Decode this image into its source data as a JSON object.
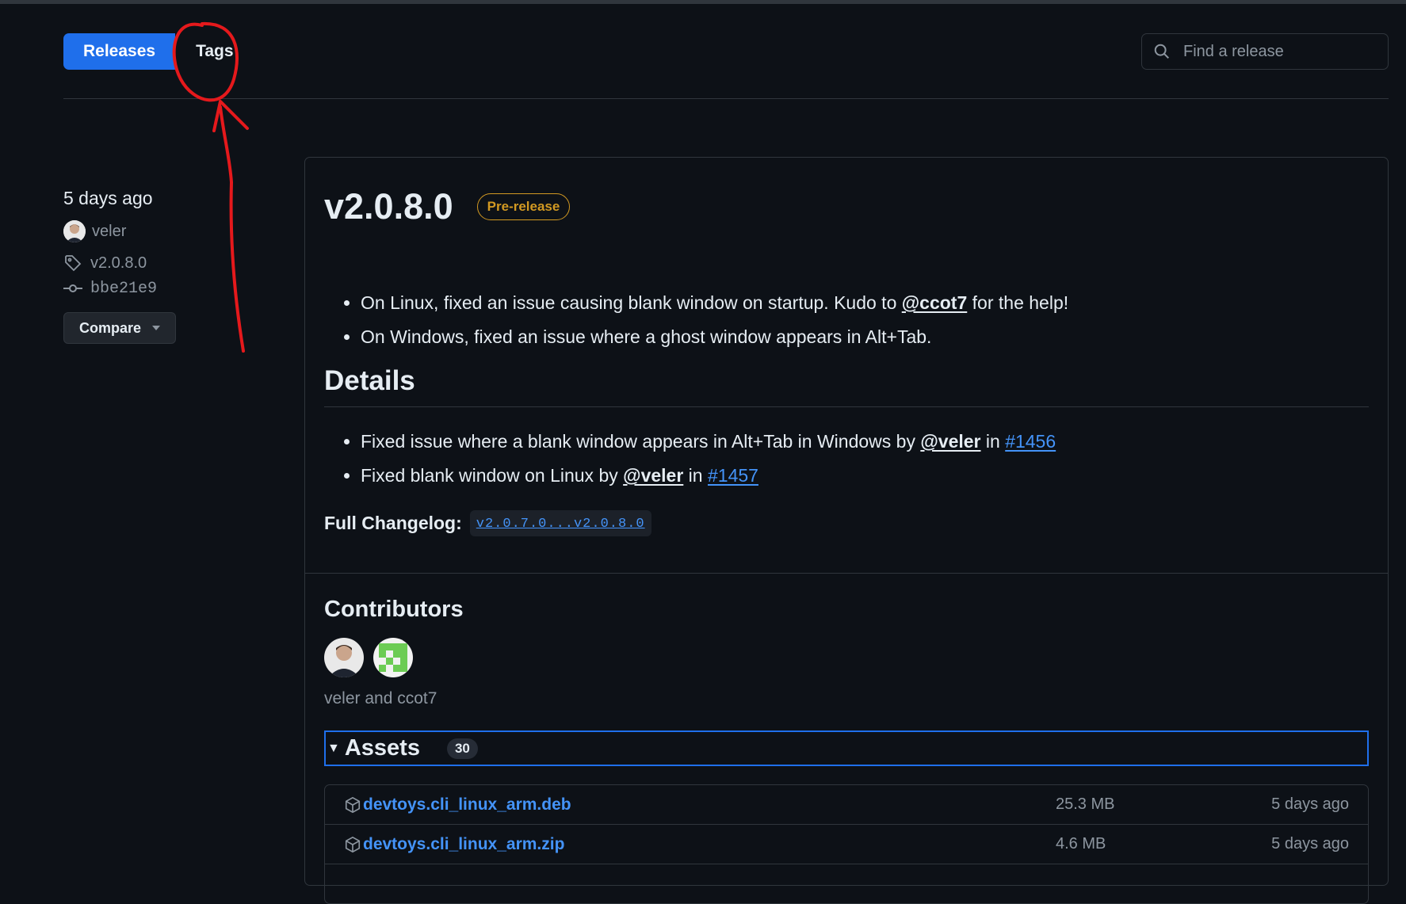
{
  "tabs": {
    "releases": "Releases",
    "tags": "Tags"
  },
  "search": {
    "placeholder": "Find a release"
  },
  "sidebar": {
    "date": "5 days ago",
    "author": "veler",
    "tag": "v2.0.8.0",
    "commit": "bbe21e9",
    "compare_label": "Compare"
  },
  "release": {
    "version": "v2.0.8.0",
    "badge": "Pre-release",
    "notes": [
      {
        "pre": "On Linux, fixed an issue causing blank window on startup. Kudo to ",
        "mention": "@ccot7",
        "post": " for the help!"
      },
      {
        "pre": "On Windows, fixed an issue where a ghost window appears in Alt+Tab."
      }
    ],
    "details_heading": "Details",
    "details": [
      {
        "pre": "Fixed issue where a blank window appears in Alt+Tab in Windows by ",
        "mention": "@veler",
        "mid": " in ",
        "link": "#1456"
      },
      {
        "pre": "Fixed blank window on Linux by ",
        "mention": "@veler",
        "mid": " in ",
        "link": "#1457"
      }
    ],
    "changelog_label": "Full Changelog:",
    "changelog_link": "v2.0.7.0...v2.0.8.0"
  },
  "contributors": {
    "heading": "Contributors",
    "names": "veler and ccot7"
  },
  "assets": {
    "label": "Assets",
    "count": "30",
    "items": [
      {
        "name": "devtoys.cli_linux_arm.deb",
        "size": "25.3 MB",
        "date": "5 days ago"
      },
      {
        "name": "devtoys.cli_linux_arm.zip",
        "size": "4.6 MB",
        "date": "5 days ago"
      }
    ]
  },
  "colors": {
    "accent": "#1f6feb",
    "link": "#4493f8",
    "prerelease": "#d29922",
    "annotation": "#e5191c"
  }
}
